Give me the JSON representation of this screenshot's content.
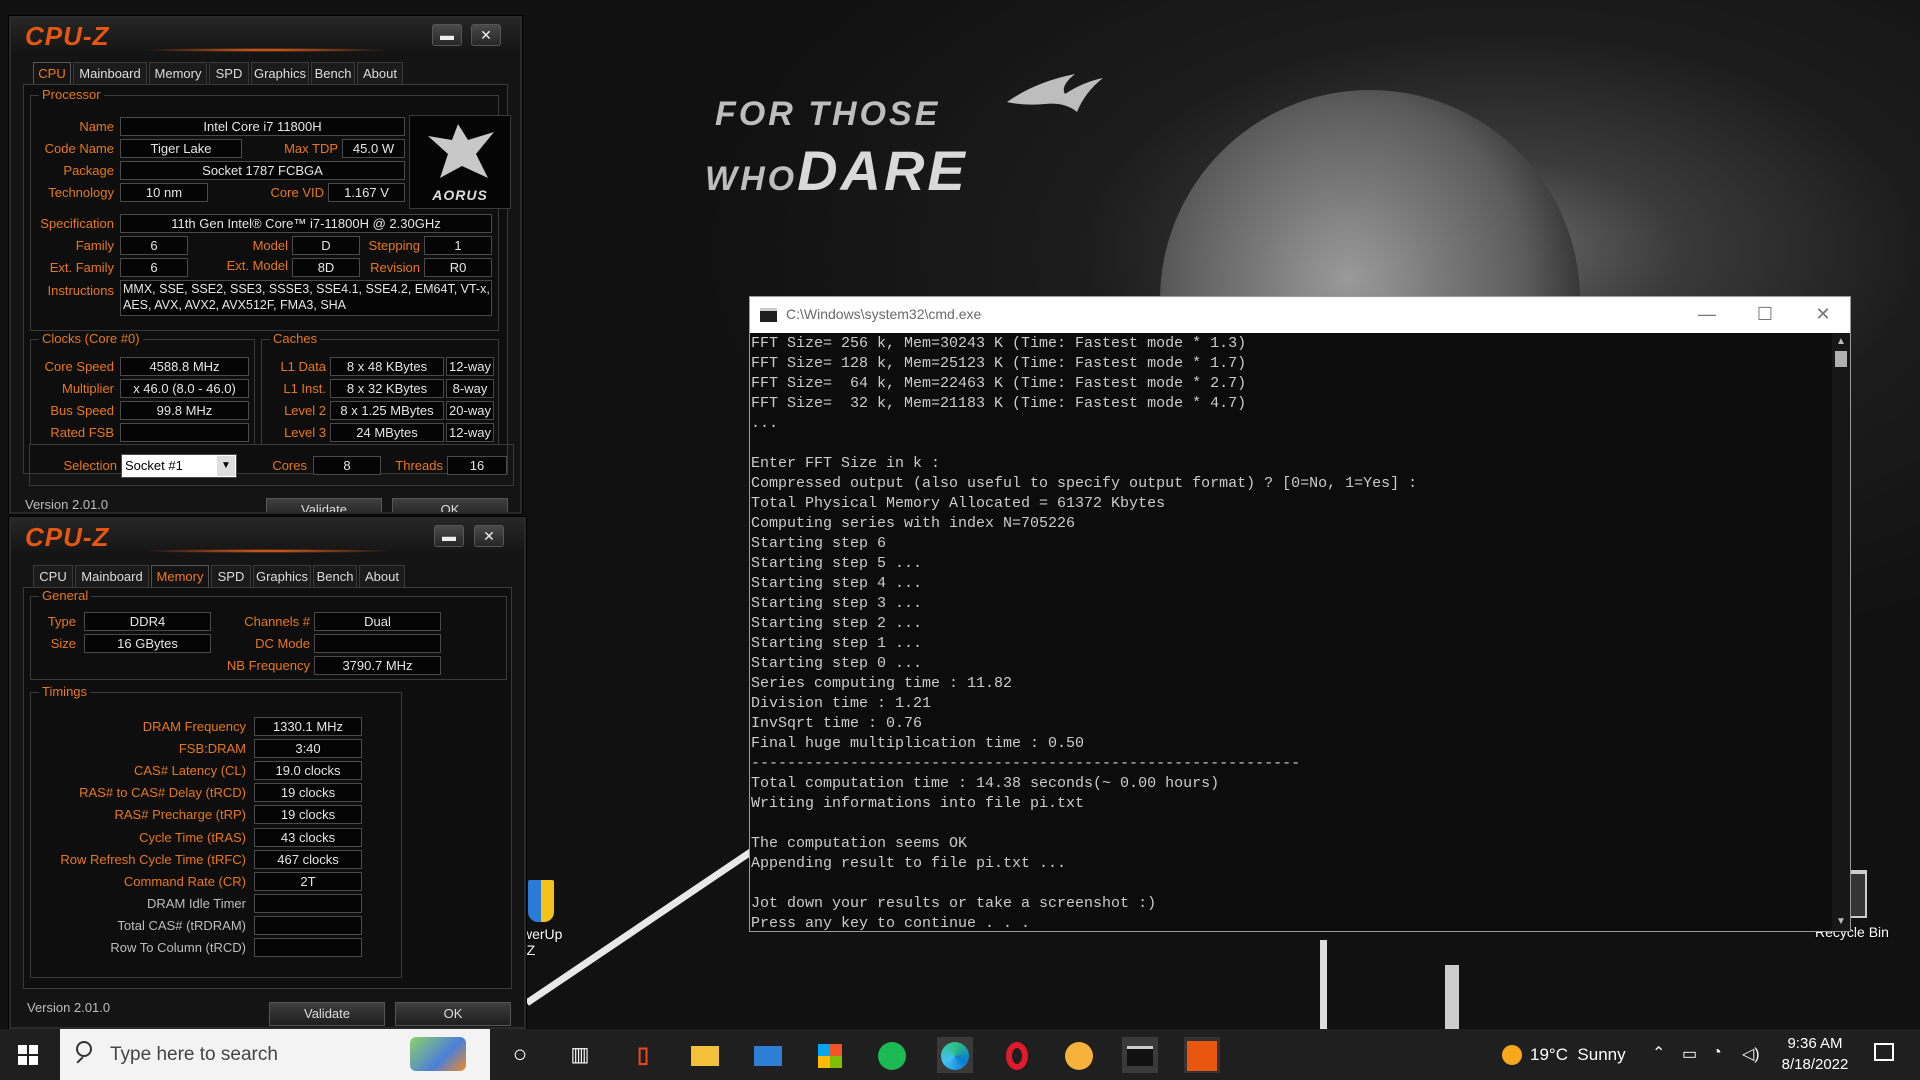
{
  "desktop": {
    "tagline_line1": "FOR THOSE",
    "tagline_line2_small": "WHO",
    "tagline_line2_big": "DARE",
    "icons": [
      {
        "label": "werUp\n-Z"
      },
      {
        "label": "Recycle Bin"
      }
    ]
  },
  "cpuz_top": {
    "title": "CPU-Z",
    "tabs": [
      "CPU",
      "Mainboard",
      "Memory",
      "SPD",
      "Graphics",
      "Bench",
      "About"
    ],
    "active_tab": "CPU",
    "processor_group": "Processor",
    "name_label": "Name",
    "name": "Intel Core i7 11800H",
    "codename_label": "Code Name",
    "codename": "Tiger Lake",
    "maxtdp_label": "Max TDP",
    "maxtdp": "45.0 W",
    "package_label": "Package",
    "package": "Socket 1787 FCBGA",
    "technology_label": "Technology",
    "technology": "10 nm",
    "corevid_label": "Core VID",
    "corevid": "1.167 V",
    "logo_text": "AORUS",
    "spec_label": "Specification",
    "spec": "11th Gen Intel® Core™ i7-11800H @ 2.30GHz",
    "family_label": "Family",
    "family": "6",
    "model_label": "Model",
    "model": "D",
    "stepping_label": "Stepping",
    "stepping": "1",
    "extfamily_label": "Ext. Family",
    "extfamily": "6",
    "extmodel_label": "Ext. Model",
    "extmodel": "8D",
    "revision_label": "Revision",
    "revision": "R0",
    "instructions_label": "Instructions",
    "instructions_1": "MMX, SSE, SSE2, SSE3, SSSE3, SSE4.1, SSE4.2, EM64T, VT-x,",
    "instructions_2": "AES, AVX, AVX2, AVX512F, FMA3, SHA",
    "clocks_group": "Clocks (Core #0)",
    "corespeed_label": "Core Speed",
    "corespeed": "4588.8 MHz",
    "multiplier_label": "Multiplier",
    "multiplier": "x 46.0 (8.0 - 46.0)",
    "busspeed_label": "Bus Speed",
    "busspeed": "99.8 MHz",
    "ratedfsb_label": "Rated FSB",
    "ratedfsb": "",
    "caches_group": "Caches",
    "l1d_label": "L1 Data",
    "l1d": "8 x 48 KBytes",
    "l1d_way": "12-way",
    "l1i_label": "L1 Inst.",
    "l1i": "8 x 32 KBytes",
    "l1i_way": "8-way",
    "l2_label": "Level 2",
    "l2": "8 x 1.25 MBytes",
    "l2_way": "20-way",
    "l3_label": "Level 3",
    "l3": "24 MBytes",
    "l3_way": "12-way",
    "selection_label": "Selection",
    "selection": "Socket #1",
    "cores_label": "Cores",
    "cores": "8",
    "threads_label": "Threads",
    "threads": "16",
    "version": "Version 2.01.0",
    "validate": "Validate",
    "ok": "OK"
  },
  "cpuz_bottom": {
    "title": "CPU-Z",
    "tabs": [
      "CPU",
      "Mainboard",
      "Memory",
      "SPD",
      "Graphics",
      "Bench",
      "About"
    ],
    "active_tab": "Memory",
    "general_group": "General",
    "type_label": "Type",
    "type": "DDR4",
    "size_label": "Size",
    "size": "16 GBytes",
    "channels_label": "Channels #",
    "channels": "Dual",
    "dcmode_label": "DC Mode",
    "dcmode": "",
    "nbfreq_label": "NB Frequency",
    "nbfreq": "3790.7 MHz",
    "timings_group": "Timings",
    "timings": [
      {
        "label": "DRAM Frequency",
        "value": "1330.1 MHz",
        "bright": true
      },
      {
        "label": "FSB:DRAM",
        "value": "3:40",
        "bright": true
      },
      {
        "label": "CAS# Latency (CL)",
        "value": "19.0 clocks",
        "bright": true
      },
      {
        "label": "RAS# to CAS# Delay (tRCD)",
        "value": "19 clocks",
        "bright": true
      },
      {
        "label": "RAS# Precharge (tRP)",
        "value": "19 clocks",
        "bright": true
      },
      {
        "label": "Cycle Time (tRAS)",
        "value": "43 clocks",
        "bright": true
      },
      {
        "label": "Row Refresh Cycle Time (tRFC)",
        "value": "467 clocks",
        "bright": true
      },
      {
        "label": "Command Rate (CR)",
        "value": "2T",
        "bright": true
      },
      {
        "label": "DRAM Idle Timer",
        "value": "",
        "bright": false
      },
      {
        "label": "Total CAS# (tRDRAM)",
        "value": "",
        "bright": false
      },
      {
        "label": "Row To Column (tRCD)",
        "value": "",
        "bright": false
      }
    ],
    "version": "Version 2.01.0",
    "validate": "Validate",
    "ok": "OK"
  },
  "cmd": {
    "title": "C:\\Windows\\system32\\cmd.exe",
    "lines": [
      "FFT Size= 256 k, Mem=30243 K (Time: Fastest mode * 1.3)",
      "FFT Size= 128 k, Mem=25123 K (Time: Fastest mode * 1.7)",
      "FFT Size=  64 k, Mem=22463 K (Time: Fastest mode * 2.7)",
      "FFT Size=  32 k, Mem=21183 K (Time: Fastest mode * 4.7)",
      "...",
      "",
      "Enter FFT Size in k :",
      "Compressed output (also useful to specify output format) ? [0=No, 1=Yes] :",
      "Total Physical Memory Allocated = 61372 Kbytes",
      "Computing series with index N=705226",
      "Starting step 6",
      "Starting step 5 ...",
      "Starting step 4 ...",
      "Starting step 3 ...",
      "Starting step 2 ...",
      "Starting step 1 ...",
      "Starting step 0 ...",
      "Series computing time : 11.82",
      "Division time : 1.21",
      "InvSqrt time : 0.76",
      "Final huge multiplication time : 0.50",
      "-------------------------------------------------------------",
      "Total computation time : 14.38 seconds(~ 0.00 hours)",
      "Writing informations into file pi.txt",
      "",
      "The computation seems OK",
      "Appending result to file pi.txt ...",
      "",
      "Jot down your results or take a screenshot :)",
      "Press any key to continue . . ."
    ]
  },
  "taskbar": {
    "search_placeholder": "Type here to search",
    "weather": "19°C  Sunny",
    "time": "9:36 AM",
    "date": "8/18/2022"
  },
  "colors": {
    "accent": "#e8781a",
    "logo": "#e8560f",
    "taskbar": "#1f1f1f"
  }
}
